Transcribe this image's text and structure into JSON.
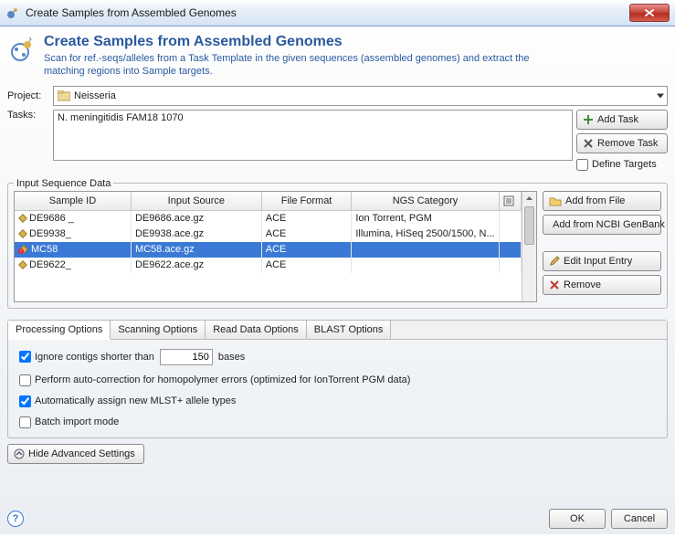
{
  "window": {
    "title": "Create Samples from Assembled Genomes"
  },
  "header": {
    "title": "Create Samples from Assembled Genomes",
    "subtitle": "Scan for ref.-seqs/alleles from a Task Template in the given sequences (assembled genomes) and extract the matching regions into Sample targets."
  },
  "labels": {
    "project": "Project:",
    "tasks": "Tasks:"
  },
  "project": {
    "name": "Neisseria"
  },
  "tasks": {
    "list": "N. meningitidis FAM18 1070"
  },
  "taskbuttons": {
    "add": "Add Task",
    "remove": "Remove Task",
    "define": "Define Targets"
  },
  "isd": {
    "legend": "Input Sequence Data",
    "headers": {
      "sample": "Sample ID",
      "source": "Input Source",
      "format": "File Format",
      "ngs": "NGS Category"
    },
    "rows": [
      {
        "sample": "DE9686 _",
        "source": "DE9686.ace.gz",
        "format": "ACE",
        "ngs": "Ion Torrent, PGM",
        "selected": false,
        "warn": false
      },
      {
        "sample": "DE9938_",
        "source": "DE9938.ace.gz",
        "format": "ACE",
        "ngs": "Illumina, HiSeq 2500/1500, N...",
        "selected": false,
        "warn": false
      },
      {
        "sample": "MC58",
        "source": "MC58.ace.gz",
        "format": "ACE",
        "ngs": "",
        "selected": true,
        "warn": true
      },
      {
        "sample": "DE9622_",
        "source": "DE9622.ace.gz",
        "format": "ACE",
        "ngs": "",
        "selected": false,
        "warn": false
      }
    ],
    "buttons": {
      "addFile": "Add from File",
      "addNcbi": "Add from NCBI GenBank",
      "edit": "Edit Input Entry",
      "remove": "Remove"
    }
  },
  "tabs": {
    "processing": "Processing Options",
    "scanning": "Scanning Options",
    "readdata": "Read Data Options",
    "blast": "BLAST Options"
  },
  "processing": {
    "ignorePrefix": "Ignore contigs shorter than",
    "ignoreValue": "150",
    "ignoreSuffix": "bases",
    "autocorrect": "Perform auto-correction for homopolymer errors (optimized for IonTorrent PGM data)",
    "mlst": "Automatically assign new MLST+ allele types",
    "batch": "Batch import mode"
  },
  "advanced": {
    "hide": "Hide Advanced Settings"
  },
  "footer": {
    "ok": "OK",
    "cancel": "Cancel"
  }
}
